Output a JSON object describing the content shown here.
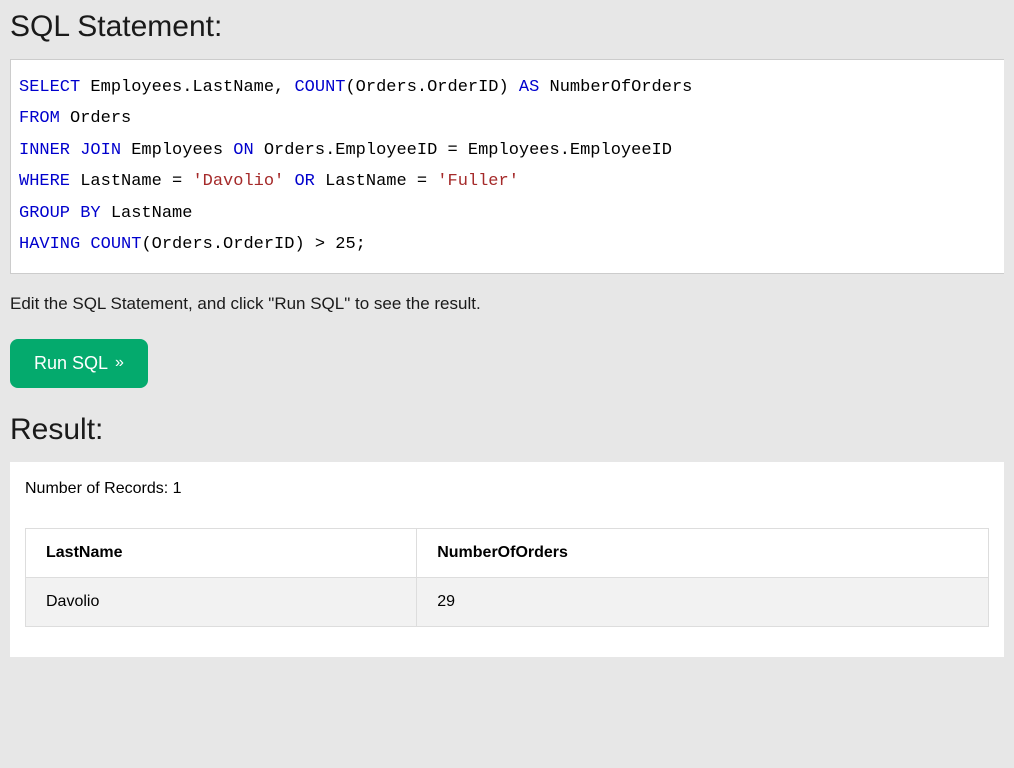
{
  "heading_statement": "SQL Statement:",
  "sql": {
    "t1": "SELECT",
    "t2": " Employees.LastName, ",
    "t3": "COUNT",
    "t4": "(Orders.OrderID) ",
    "t5": "AS",
    "t6": " NumberOfOrders",
    "t7": "FROM",
    "t8": " Orders",
    "t9": "INNER",
    "t10": " ",
    "t11": "JOIN",
    "t12": " Employees ",
    "t13": "ON",
    "t14": " Orders.EmployeeID = Employees.EmployeeID",
    "t15": "WHERE",
    "t16": " LastName = ",
    "t17": "'Davolio'",
    "t18": " ",
    "t19": "OR",
    "t20": " LastName = ",
    "t21": "'Fuller'",
    "t22": "GROUP",
    "t23": " ",
    "t24": "BY",
    "t25": " LastName",
    "t26": "HAVING",
    "t27": " ",
    "t28": "COUNT",
    "t29": "(Orders.OrderID) > 25;"
  },
  "instruction": "Edit the SQL Statement, and click \"Run SQL\" to see the result.",
  "run_button": "Run SQL",
  "heading_result": "Result:",
  "records_label": "Number of Records: ",
  "records_count": "1",
  "columns": {
    "c0": "LastName",
    "c1": "NumberOfOrders"
  },
  "row0": {
    "c0": "Davolio",
    "c1": "29"
  }
}
